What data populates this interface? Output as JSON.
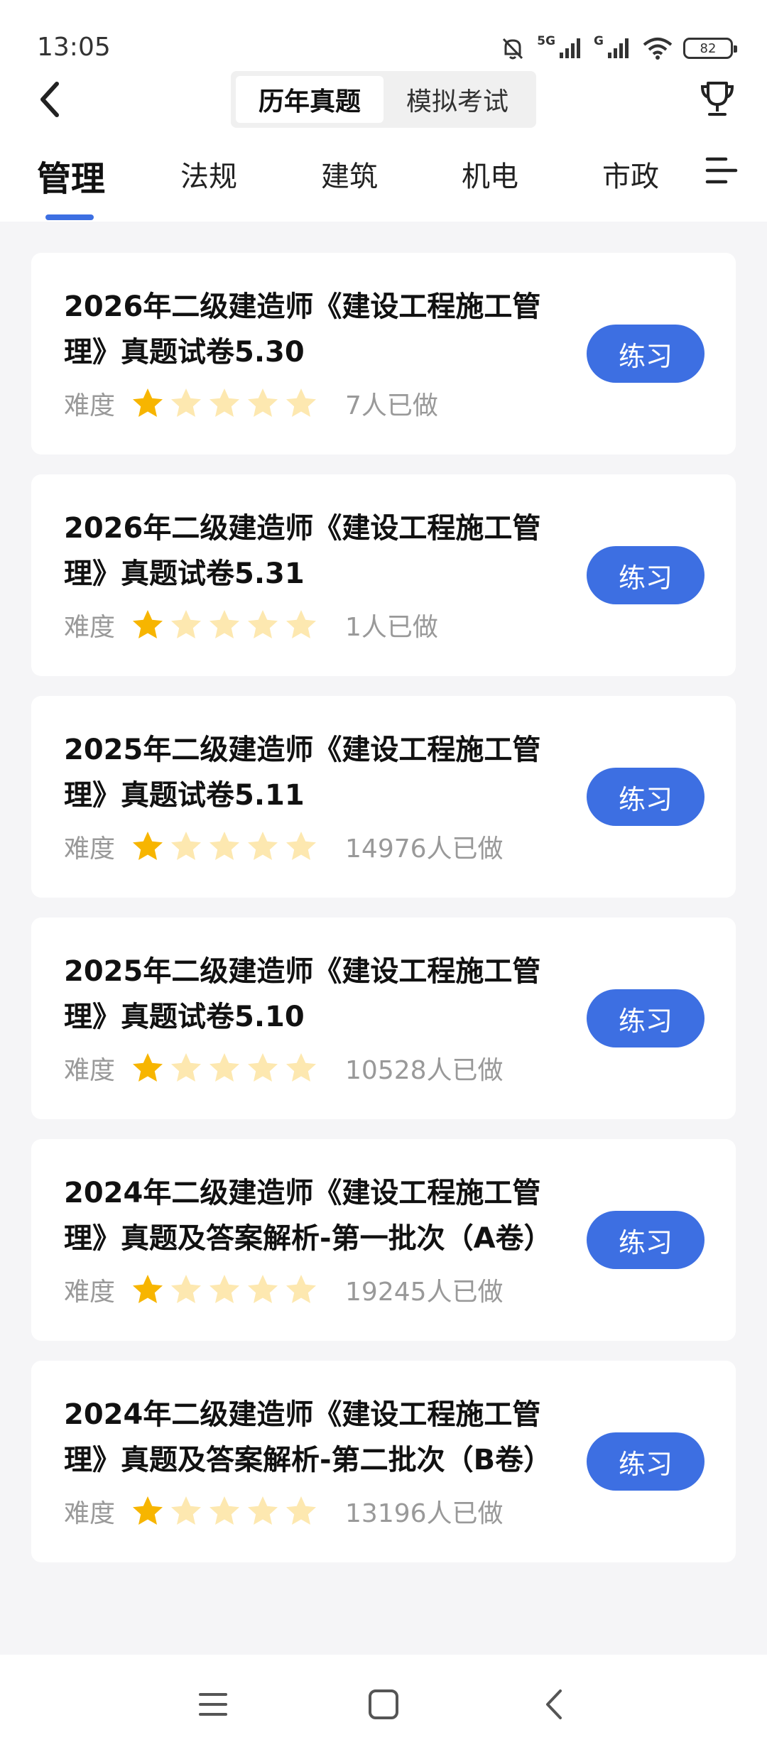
{
  "status": {
    "time": "13:05",
    "net1": "5G",
    "net2": "G",
    "battery": "82"
  },
  "nav": {
    "tabs": [
      {
        "label": "历年真题",
        "active": true
      },
      {
        "label": "模拟考试",
        "active": false
      }
    ]
  },
  "categories": [
    {
      "label": "管理",
      "active": true
    },
    {
      "label": "法规",
      "active": false
    },
    {
      "label": "建筑",
      "active": false
    },
    {
      "label": "机电",
      "active": false
    },
    {
      "label": "市政",
      "active": false
    }
  ],
  "difficulty_label": "难度",
  "practice_label": "练习",
  "colors": {
    "accent": "#3d6fe2",
    "star_filled": "#f7b500",
    "star_empty": "#fde8b0"
  },
  "papers": [
    {
      "title": "2026年二级建造师《建设工程施工管理》真题试卷5.30",
      "difficulty": 1,
      "count": "7人已做"
    },
    {
      "title": "2026年二级建造师《建设工程施工管理》真题试卷5.31",
      "difficulty": 1,
      "count": "1人已做"
    },
    {
      "title": "2025年二级建造师《建设工程施工管理》真题试卷5.11",
      "difficulty": 1,
      "count": "14976人已做"
    },
    {
      "title": "2025年二级建造师《建设工程施工管理》真题试卷5.10",
      "difficulty": 1,
      "count": "10528人已做"
    },
    {
      "title": "2024年二级建造师《建设工程施工管理》真题及答案解析-第一批次（A卷）",
      "difficulty": 1,
      "count": "19245人已做"
    },
    {
      "title": "2024年二级建造师《建设工程施工管理》真题及答案解析-第二批次（B卷）",
      "difficulty": 1,
      "count": "13196人已做"
    }
  ]
}
